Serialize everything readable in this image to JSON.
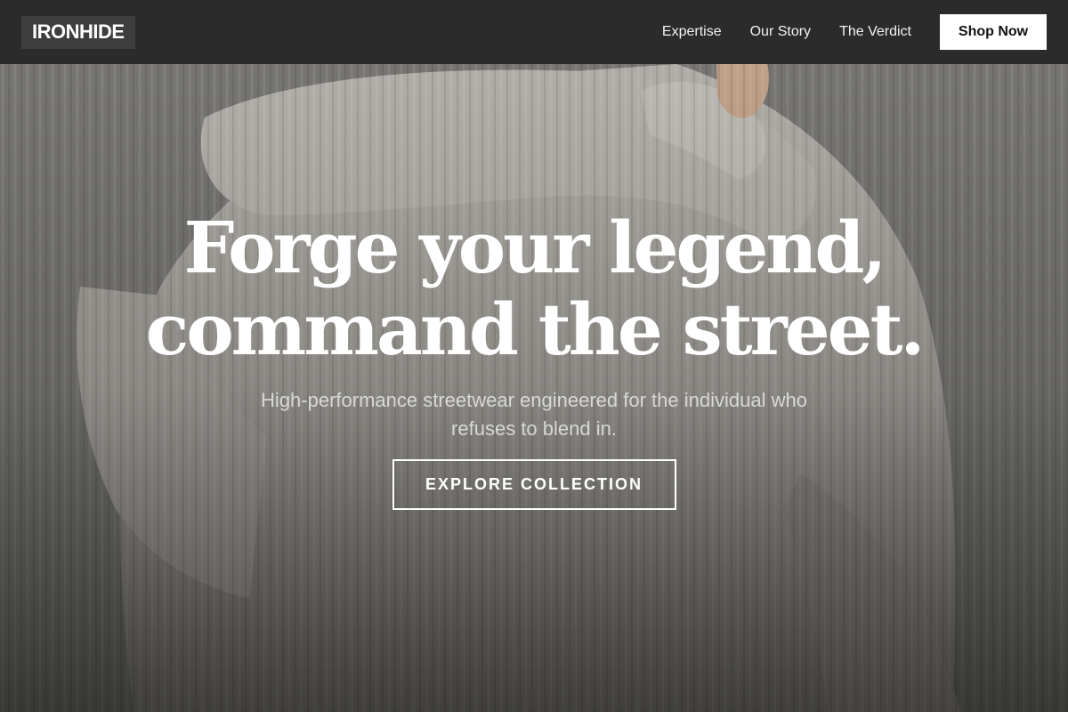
{
  "brand": {
    "logo_text": "IRONHIDE"
  },
  "nav": {
    "links": [
      "Expertise",
      "Our Story",
      "The Verdict"
    ],
    "cta_label": "Shop Now"
  },
  "hero": {
    "title_line1": "Forge your legend,",
    "title_line2": "command the street.",
    "subtitle": "High-performance streetwear engineered for the individual who refuses to blend in.",
    "cta_label": "EXPLORE COLLECTION",
    "background_image": "knit-sweater-photo"
  },
  "colors": {
    "header_bg": "#2b2b2b",
    "logo_bg": "#3d3d3d",
    "text_primary": "#ffffff",
    "text_muted": "#d8d8d8",
    "shop_button_bg": "#ffffff"
  }
}
